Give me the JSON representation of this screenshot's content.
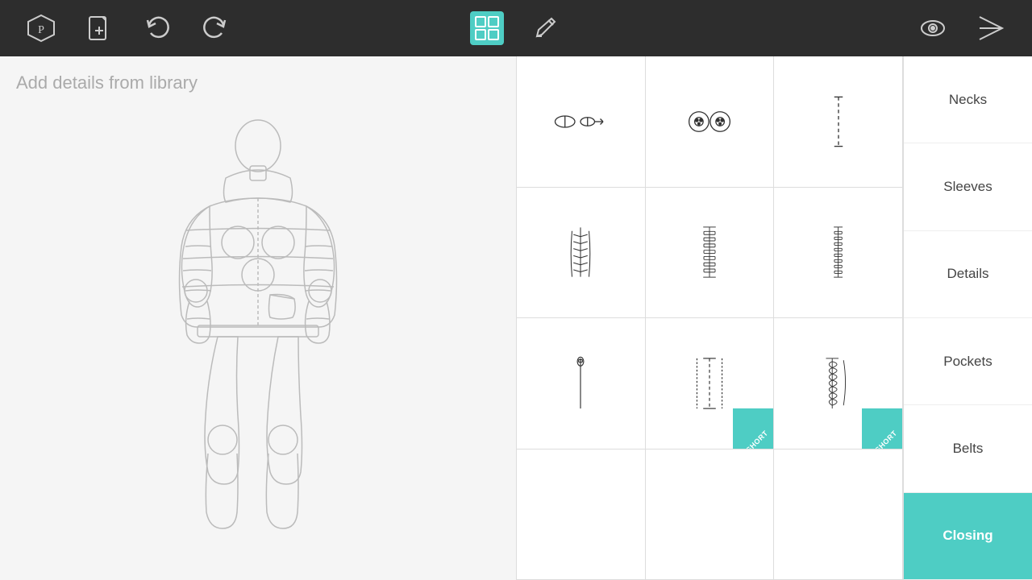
{
  "toolbar": {
    "logo_label": "logo",
    "new_label": "new",
    "undo_label": "undo",
    "redo_label": "redo",
    "library_label": "library",
    "draw_label": "draw",
    "view_label": "view",
    "send_label": "send"
  },
  "canvas": {
    "hint": "Add details from library"
  },
  "categories": [
    {
      "id": "necks",
      "label": "Necks",
      "active": false
    },
    {
      "id": "sleeves",
      "label": "Sleeves",
      "active": false
    },
    {
      "id": "details",
      "label": "Details",
      "active": false
    },
    {
      "id": "pockets",
      "label": "Pockets",
      "active": false
    },
    {
      "id": "belts",
      "label": "Belts",
      "active": false
    },
    {
      "id": "closing",
      "label": "Closing",
      "active": true
    }
  ],
  "grid": {
    "rows": 4,
    "cols": 3
  }
}
